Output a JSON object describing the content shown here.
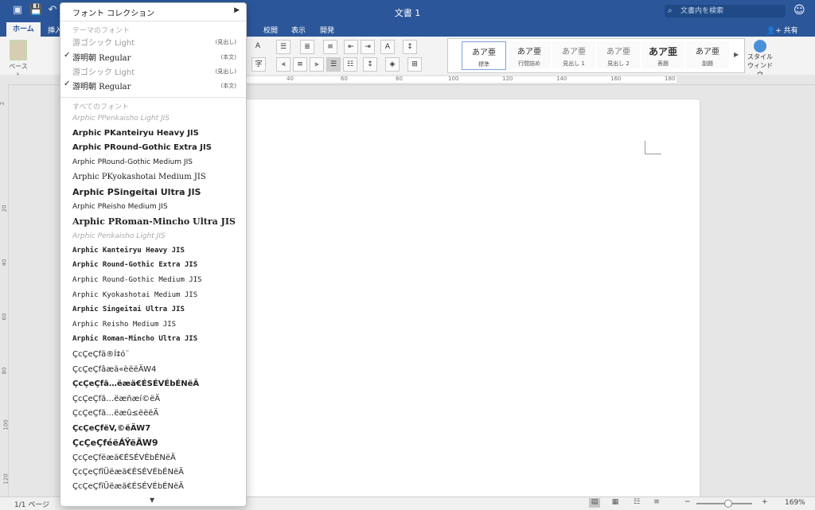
{
  "window": {
    "title": "文書 1"
  },
  "search": {
    "placeholder": "文書内を検索"
  },
  "ribbon_tabs": [
    "ホーム",
    "挿入",
    "校閲",
    "表示",
    "開発"
  ],
  "share_label": "共有",
  "paste_label": "ペースト",
  "styles": [
    {
      "sample": "あア亜",
      "label": "標準"
    },
    {
      "sample": "あア亜",
      "label": "行間詰め"
    },
    {
      "sample": "あア亜",
      "label": "見出し 1"
    },
    {
      "sample": "あア亜",
      "label": "見出し 2"
    },
    {
      "sample": "あア亜",
      "label": "表題"
    },
    {
      "sample": "あア亜",
      "label": "副題"
    }
  ],
  "style_window_label": "スタイル ウィンドウ",
  "ruler_numbers": [
    "40",
    "60",
    "80",
    "100",
    "120",
    "140",
    "160",
    "180"
  ],
  "vruler_numbers": [
    "2",
    "20",
    "40",
    "60",
    "80",
    "100",
    "120"
  ],
  "font_menu": {
    "header": "フォント コレクション",
    "theme_title": "テーマのフォント",
    "theme_fonts": [
      {
        "name": "游ゴシック Light",
        "tag": "(見出し)",
        "checked": false,
        "disabled": true
      },
      {
        "name": "游明朝 Regular",
        "tag": "(本文)",
        "checked": true,
        "disabled": false
      },
      {
        "name": "游ゴシック Light",
        "tag": "(見出し)",
        "checked": false,
        "disabled": true
      },
      {
        "name": "游明朝 Regular",
        "tag": "(本文)",
        "checked": true,
        "disabled": false
      }
    ],
    "all_title": "すべてのフォント",
    "all_fonts": [
      "Arphic PPenkaisho Light JIS",
      "Arphic PKanteiryu Heavy JIS",
      "Arphic PRound-Gothic Extra JIS",
      "Arphic PRound-Gothic Medium JIS",
      "Arphic PKyokashotai Medium JIS",
      "Arphic PSingeitai Ultra JIS",
      "Arphic PReisho Medium JIS",
      "Arphic PRoman-Mincho Ultra JIS",
      "Arphic Penkaisho Light JIS",
      "Arphic Kanteiryu Heavy JIS",
      "Arphic Round-Gothic Extra JIS",
      "Arphic Round-Gothic Medium JIS",
      "Arphic Kyokashotai Medium JIS",
      "Arphic Singeitai Ultra JIS",
      "Arphic Reisho Medium JIS",
      "Arphic Roman-Mincho Ultra JIS",
      "ÇcÇeÇfä®Í‡ó¨",
      "ÇcÇeÇfâæä«èëëÄW4",
      "ÇcÇeÇfã…ëæä€ÉSÉVÉbÉNëÄ",
      "ÇcÇeÇfã…ëæñæí©ëÄ",
      "ÇcÇeÇfã…ëæû≤ëëëÄ",
      "ÇcÇeÇfëV,©ëÄW7",
      "ÇcÇeÇféëÁŸëÄW9",
      "ÇcÇeÇfëæä€ÉSÉVÉbÉNëÄ",
      "ÇcÇeÇfîÜëæä€ÉSÉVÉbÉNëÄ",
      "ÇcÇeÇfïÜëæä€ÉSÉVÉbÉNëÄ"
    ]
  },
  "status": {
    "page": "1/1 ページ",
    "zoom": "169%"
  }
}
